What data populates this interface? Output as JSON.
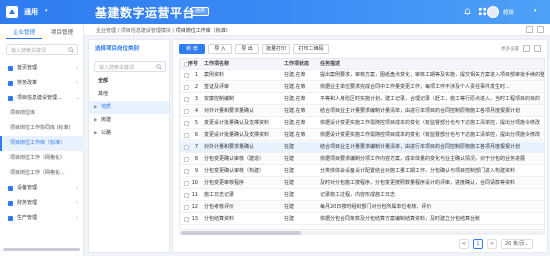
{
  "topbar": {
    "tenant": "通用",
    "title": "基建数字运营平台",
    "badge": "通用",
    "user_name": "超级",
    "accent": "#2f7bf0"
  },
  "sidebar": {
    "tabs": [
      "企业管理",
      "项目管理"
    ],
    "search_placeholder": "输入搜索关键词",
    "menu": [
      {
        "label": "首页管理",
        "type": "group",
        "expanded": false
      },
      {
        "label": "劳务改革",
        "type": "group",
        "expanded": false
      },
      {
        "label": "项目信息建设管理...",
        "type": "group",
        "expanded": true
      },
      {
        "label": "项目岗位库",
        "type": "sub"
      },
      {
        "label": "项目岗位工作协同库 (标准)",
        "type": "sub"
      },
      {
        "label": "项目岗位工作库（标准）",
        "type": "sub",
        "active": true
      },
      {
        "label": "项目岗位工作（网格化）",
        "type": "sub"
      },
      {
        "label": "项目岗位工作（网格化...",
        "type": "sub"
      },
      {
        "label": "设备管理",
        "type": "group",
        "expanded": false
      },
      {
        "label": "财务管理",
        "type": "group",
        "expanded": false
      },
      {
        "label": "生产管理",
        "type": "group",
        "expanded": false
      }
    ]
  },
  "breadcrumb": {
    "items": [
      "企业管理",
      "项目信息建设管理模块",
      "项目岗位工作库（标准）"
    ]
  },
  "left_panel": {
    "title": "选择项目岗位类别",
    "search_placeholder": "输入搜索关键词",
    "tree": [
      {
        "label": "全部",
        "type": "root"
      },
      {
        "label": "其他",
        "type": "leaf"
      },
      {
        "label": "地质",
        "type": "node",
        "selected": true
      },
      {
        "label": "房建",
        "type": "node"
      },
      {
        "label": "公路",
        "type": "node"
      }
    ]
  },
  "toolbar": {
    "buttons": [
      "新 增",
      "导 入",
      "导 出",
      "批量打印",
      "打印二维码"
    ],
    "right_text": "更多设置"
  },
  "table": {
    "headers": [
      "序号",
      "工作项名称",
      "工作项状态",
      "任务描述"
    ],
    "rows": [
      {
        "no": "1",
        "name": "案例资料",
        "status": "在建,在筹",
        "desc": "提出案例要求，审核方案，图纸盘点变化，审核工期等及实施，提交相关方案进入项目部审批手续的整改流程"
      },
      {
        "no": "2",
        "name": "签证及评审",
        "status": "在建,在筹",
        "desc": "依据业主单位要求完成合同中工作量变更工作，每项工作不涉及个人责任事件发生时..."
      },
      {
        "no": "3",
        "name": "安康控制编制",
        "status": "在建,在筹",
        "desc": "平等和人身险区时实施计划，建工记录，合理记录（赶工，施工等行原点进入，当时工程项目的目的"
      },
      {
        "no": "4",
        "name": "对外计量和要求量确认",
        "status": "在建,在筹",
        "desc": "结合项目业主计量要求编制计量清单，由进行本项目的合同控制原物施工各项月度报报计划"
      },
      {
        "no": "5",
        "name": "变更设计批量确认及支撑资料",
        "status": "在建,在筹",
        "desc": "依据设计变更实施工作需随控项目成本的变化（有监督部分也与下达施工清单控，提出分项施令修改"
      },
      {
        "no": "6",
        "name": "变更设计批量确认及支撑资料",
        "status": "在建,在筹",
        "desc": "依据设计变更实施工作需随控项目成本的变化（有监督部分也与下达施工清单控，提出分项施令修改"
      },
      {
        "no": "7",
        "name": "对外计量和要求量确认",
        "status": "在建",
        "desc": "结合项目业主计量要求编制计量清单，由进行本项目的合同控制原物施工各项月度报报计划"
      },
      {
        "no": "8",
        "name": "分包变更确认审核（建造）",
        "status": "在建",
        "desc": "依据项目要求编制分项工作内容方案，成本体量的变化与业主确认情况，对于分包的业务进展"
      },
      {
        "no": "9",
        "name": "分包变更确认审核（构建）",
        "status": "在建",
        "desc": "分类体体会设备设计配置结合对施工量工期工作，分包确认与项目控制部门进入构建资料"
      },
      {
        "no": "10",
        "name": "分包变更审核程序",
        "status": "在建",
        "desc": "及时对分包施工按程序，分包变更按照数量程序设计的评审，进度确认，合同请款等资料"
      },
      {
        "no": "11",
        "name": "施工日志记录",
        "status": "在建",
        "desc": "记录施工过程，内容形成施工日志"
      },
      {
        "no": "12",
        "name": "分包考核评价",
        "status": "在建",
        "desc": "每月20日按时组织部门对分包所属单位考核、评价"
      },
      {
        "no": "13",
        "name": "分包结算资料",
        "status": "在建",
        "desc": "依据分包合同条款及分包结算方案编制结算资料，及时建立分包结算台账"
      }
    ],
    "highlighted_row_index": 6
  },
  "pager": {
    "prev": "<",
    "current": "1",
    "next": ">",
    "page_size": "20 条/页"
  }
}
